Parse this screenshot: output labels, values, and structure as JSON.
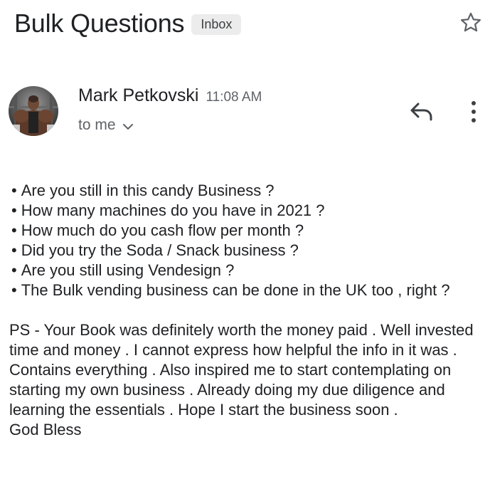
{
  "email": {
    "subject": "Bulk Questions",
    "label": "Inbox",
    "sender": {
      "name": "Mark Petkovski",
      "time": "11:08 AM",
      "recipient": "to me"
    },
    "bullets": [
      "Are you still in this candy Business ?",
      "How many machines do you have in 2021 ?",
      "How much do you cash flow per month ?",
      "Did you try the Soda / Snack business ?",
      "Are you still using Vendesign ?",
      "The Bulk vending business can be done in the UK too , right ?"
    ],
    "bullet_mark": "•",
    "ps": "PS - Your Book was definitely worth the money paid . Well invested time and money . I cannot express how helpful the info in it was . Contains everything . Also inspired me to start contemplating on starting my own business . Already doing my due diligence and learning the essentials . Hope I start the business soon .",
    "closing": "God Bless"
  },
  "icons": {
    "star": "star-outline-icon",
    "reply": "reply-icon",
    "more": "more-vert-icon",
    "expand": "chevron-down-icon"
  },
  "colors": {
    "text": "#202124",
    "secondary": "#5f6368",
    "chip_bg": "#ececec"
  }
}
